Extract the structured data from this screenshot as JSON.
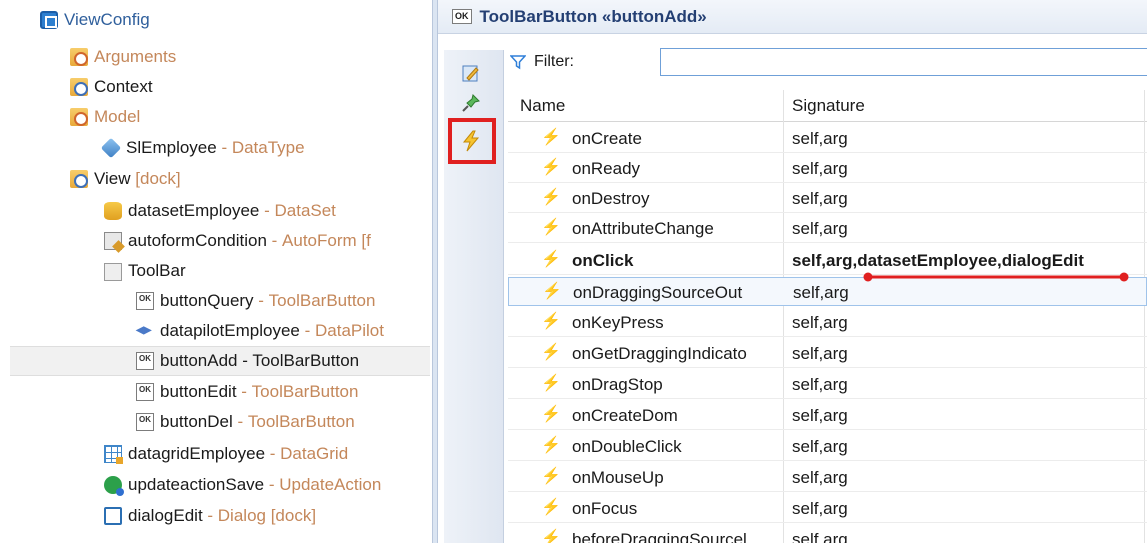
{
  "tree": {
    "items": [
      {
        "name": "ViewConfig",
        "sep": "",
        "type": "",
        "icon": "viewconfig-icon",
        "dim": false
      },
      {
        "name": "Arguments",
        "sep": "",
        "type": "",
        "icon": "folder-icon",
        "dim": true
      },
      {
        "name": "Context",
        "sep": "",
        "type": "",
        "icon": "folder-icon",
        "dim": false
      },
      {
        "name": "Model",
        "sep": "",
        "type": "",
        "icon": "folder-icon",
        "dim": true
      },
      {
        "name": "SlEmployee",
        "sep": " - ",
        "type": "DataType",
        "icon": "datatype-icon",
        "dim": false
      },
      {
        "name": "View",
        "sep": " ",
        "type": "[dock]",
        "icon": "folder-icon",
        "dim": false
      },
      {
        "name": "datasetEmployee",
        "sep": " - ",
        "type": "DataSet",
        "icon": "dataset-icon",
        "dim": false
      },
      {
        "name": "autoformCondition",
        "sep": " - ",
        "type": "AutoForm [f",
        "icon": "autoform-icon",
        "dim": false
      },
      {
        "name": "ToolBar",
        "sep": "",
        "type": "",
        "icon": "toolbar-icon",
        "dim": false
      },
      {
        "name": "buttonQuery",
        "sep": " - ",
        "type": "ToolBarButton",
        "icon": "toolbar-button-icon",
        "dim": false
      },
      {
        "name": "datapilotEmployee",
        "sep": " - ",
        "type": "DataPilot",
        "icon": "datapilot-icon",
        "dim": false
      },
      {
        "name": "buttonAdd - ToolBarButton",
        "sep": "",
        "type": "",
        "icon": "toolbar-button-icon",
        "dim": false
      },
      {
        "name": "buttonEdit",
        "sep": " - ",
        "type": "ToolBarButton",
        "icon": "toolbar-button-icon",
        "dim": false
      },
      {
        "name": "buttonDel",
        "sep": " - ",
        "type": "ToolBarButton",
        "icon": "toolbar-button-icon",
        "dim": false
      },
      {
        "name": "datagridEmployee",
        "sep": " - ",
        "type": "DataGrid",
        "icon": "datagrid-icon",
        "dim": false
      },
      {
        "name": "updateactionSave",
        "sep": " - ",
        "type": "UpdateAction",
        "icon": "updateaction-icon",
        "dim": false
      },
      {
        "name": "dialogEdit",
        "sep": " - ",
        "type": "Dialog [dock]",
        "icon": "dialog-icon",
        "dim": false
      }
    ]
  },
  "header": {
    "badge": "OK",
    "title": "ToolBarButton «buttonAdd»"
  },
  "filter": {
    "label": "Filter:",
    "value": ""
  },
  "grid": {
    "columns": [
      "Name",
      "Signature"
    ],
    "rows": [
      {
        "name": "onCreate",
        "signature": "self,arg"
      },
      {
        "name": "onReady",
        "signature": "self,arg"
      },
      {
        "name": "onDestroy",
        "signature": "self,arg"
      },
      {
        "name": "onAttributeChange",
        "signature": "self,arg"
      },
      {
        "name": "onClick",
        "signature": "self,arg,datasetEmployee,dialogEdit"
      },
      {
        "name": "onDraggingSourceOut",
        "signature": "self,arg"
      },
      {
        "name": "onKeyPress",
        "signature": "self,arg"
      },
      {
        "name": "onGetDraggingIndicato",
        "signature": "self,arg"
      },
      {
        "name": "onDragStop",
        "signature": "self,arg"
      },
      {
        "name": "onCreateDom",
        "signature": "self,arg"
      },
      {
        "name": "onDoubleClick",
        "signature": "self,arg"
      },
      {
        "name": "onMouseUp",
        "signature": "self,arg"
      },
      {
        "name": "onFocus",
        "signature": "self,arg"
      },
      {
        "name": "beforeDraggingSourcel",
        "signature": "self,arg"
      }
    ]
  },
  "colors": {
    "highlight": "#e02020",
    "type_text": "#c4875a",
    "title_text": "#243f73"
  }
}
